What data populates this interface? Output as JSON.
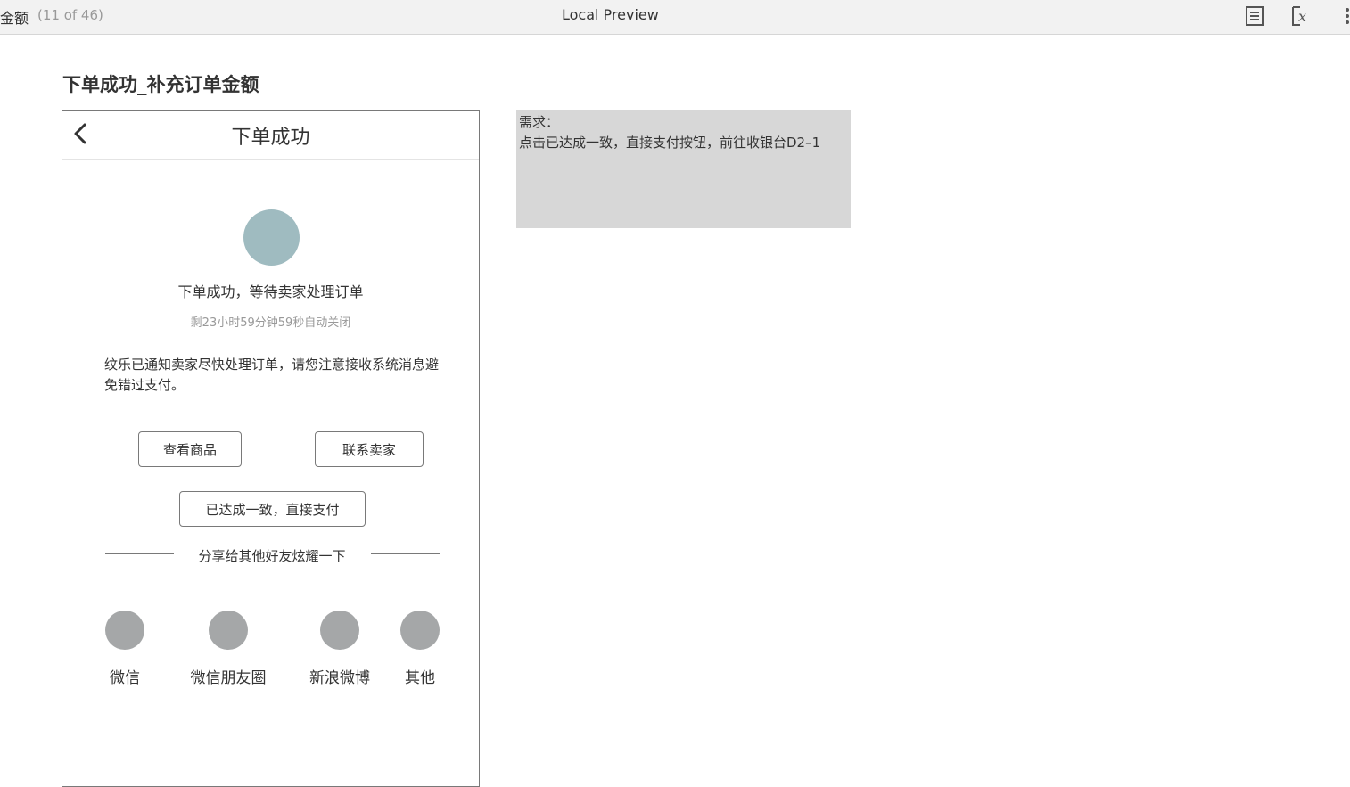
{
  "topbar": {
    "page_name": "金额",
    "page_count": "(11 of 46)",
    "app_title": "Local Preview"
  },
  "page": {
    "heading": "下单成功_补充订单金额"
  },
  "phone": {
    "nav_title": "下单成功",
    "status_text": "下单成功，等待卖家处理订单",
    "countdown": "剩23小时59分钟59秒自动关闭",
    "notice": "纹乐已通知卖家尽快处理订单，请您注意接收系统消息避免错过支付。",
    "buttons": {
      "view_goods": "查看商品",
      "contact_seller": "联系卖家",
      "pay_direct": "已达成一致，直接支付"
    },
    "share": {
      "title": "分享给其他好友炫耀一下",
      "items": [
        {
          "label": "微信"
        },
        {
          "label": "微信朋友圈"
        },
        {
          "label": "新浪微博"
        },
        {
          "label": "其他"
        }
      ]
    }
  },
  "note": {
    "title": "需求：",
    "text": "点击已达成一致，直接支付按钮，前往收银台D2–1"
  }
}
